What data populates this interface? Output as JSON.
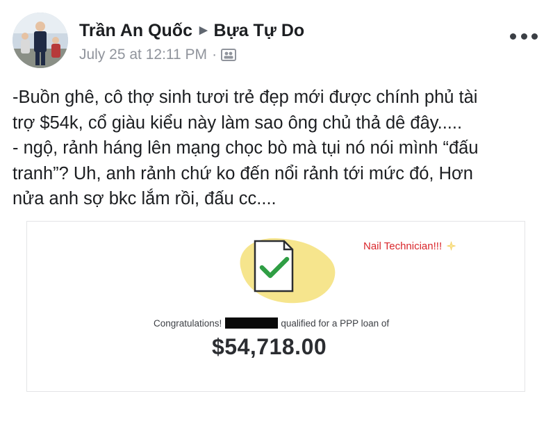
{
  "post": {
    "author": "Trần An Quốc",
    "group": "Bựa Tự Do",
    "timestamp": "July 25 at 12:11 PM",
    "meta_separator": "·",
    "audience_icon": "group-audience-icon",
    "more_icon": "more-options-icon",
    "text_lines": [
      "-Buồn ghê, cô thợ sinh tươi trẻ đẹp mới được chính phủ tài",
      "trợ $54k, cổ giàu kiểu này làm sao ông chủ thả dê đây.....",
      "- ngộ, rảnh háng lên mạng chọc bò mà tụi nó nói mình “đấu",
      "tranh”? Uh, anh rảnh chứ ko đến nổi rảnh tới mức đó, Hơn",
      "nửa anh sợ bkc lắm rồi, đấu cc...."
    ]
  },
  "attachment": {
    "annotation": "Nail Technician!!!",
    "annotation_icon": "sparkle-icon",
    "congrats_prefix": "Congratulations!",
    "congrats_suffix": "qualified for a PPP loan of",
    "amount": "$54,718.00",
    "colors": {
      "blob": "#f6e58d",
      "check": "#2f9e44",
      "annotation": "#d9262b"
    }
  }
}
